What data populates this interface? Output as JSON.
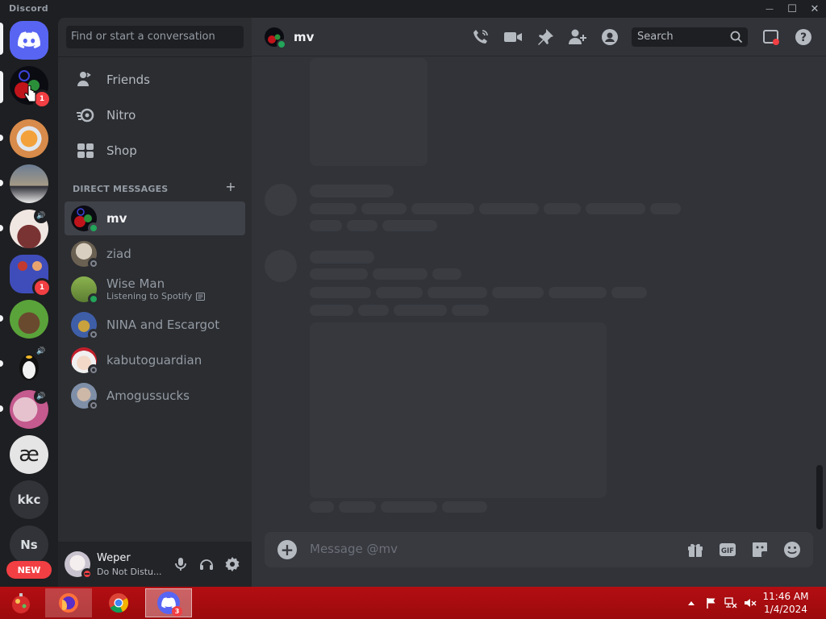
{
  "app": {
    "wordmark": "Discord"
  },
  "window_controls": {
    "minimize": "—",
    "maximize": "☐",
    "close": "✕"
  },
  "servers": {
    "badges": {
      "active_server": "1",
      "server_5": "1"
    },
    "text_servers": [
      "æ",
      "kkc",
      "Ns"
    ],
    "new_badge": "NEW"
  },
  "sidebar": {
    "search_placeholder": "Find or start a conversation",
    "nav": [
      {
        "label": "Friends",
        "icon": "friends-icon"
      },
      {
        "label": "Nitro",
        "icon": "nitro-icon"
      },
      {
        "label": "Shop",
        "icon": "shop-icon"
      }
    ],
    "dm_header": "DIRECT MESSAGES",
    "dm_add": "+",
    "dms": [
      {
        "name": "mv",
        "status": "online",
        "sub": ""
      },
      {
        "name": "ziad",
        "status": "offline",
        "sub": ""
      },
      {
        "name": "Wise Man",
        "status": "online",
        "sub": "Listening to Spotify"
      },
      {
        "name": "NINA and Escargot",
        "status": "offline",
        "sub": ""
      },
      {
        "name": "kabutoguardian",
        "status": "offline",
        "sub": ""
      },
      {
        "name": "Amogussucks",
        "status": "offline",
        "sub": ""
      }
    ]
  },
  "user_panel": {
    "username": "Weper",
    "status": "Do Not Distu..."
  },
  "chat": {
    "channel_name": "mv",
    "search_placeholder": "Search",
    "message_placeholder": "Message @mv"
  },
  "taskbar": {
    "discord_badge": "3",
    "time": "11:46 AM",
    "date": "1/4/2024"
  },
  "colors": {
    "blurple": "#5865f2",
    "online": "#23a55a",
    "dnd": "#f23f43",
    "taskbar": "#b30e12"
  }
}
